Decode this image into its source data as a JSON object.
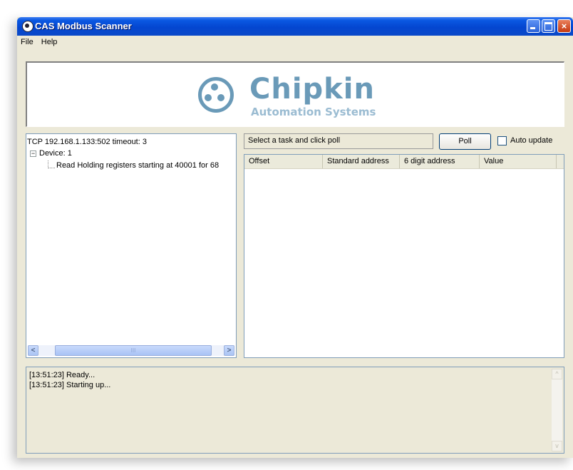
{
  "window": {
    "title": "CAS Modbus Scanner",
    "close_glyph": "×"
  },
  "menu": [
    "File",
    "Help"
  ],
  "banner": {
    "company": "Chipkin",
    "tagline": "Automation Systems"
  },
  "tree": {
    "connection": "TCP 192.168.1.133:502 timeout: 3",
    "device": "Device: 1",
    "task": "Read Holding registers starting at 40001 for 68",
    "expander": "−"
  },
  "task_status": "Select a task and click poll",
  "poll_label": "Poll",
  "auto_update_label": "Auto update",
  "grid": {
    "columns": [
      "Offset",
      "Standard address",
      "6 digit address",
      "Value"
    ]
  },
  "log": {
    "lines": [
      "[13:51:23] Ready...",
      "[13:51:23] Starting up..."
    ]
  },
  "scroll": {
    "left": "<",
    "right": ">",
    "thumb": "III",
    "up": "^",
    "down": "v"
  },
  "colors": {
    "titlebar": "#0446d0",
    "logo": "#6a9ab8"
  }
}
